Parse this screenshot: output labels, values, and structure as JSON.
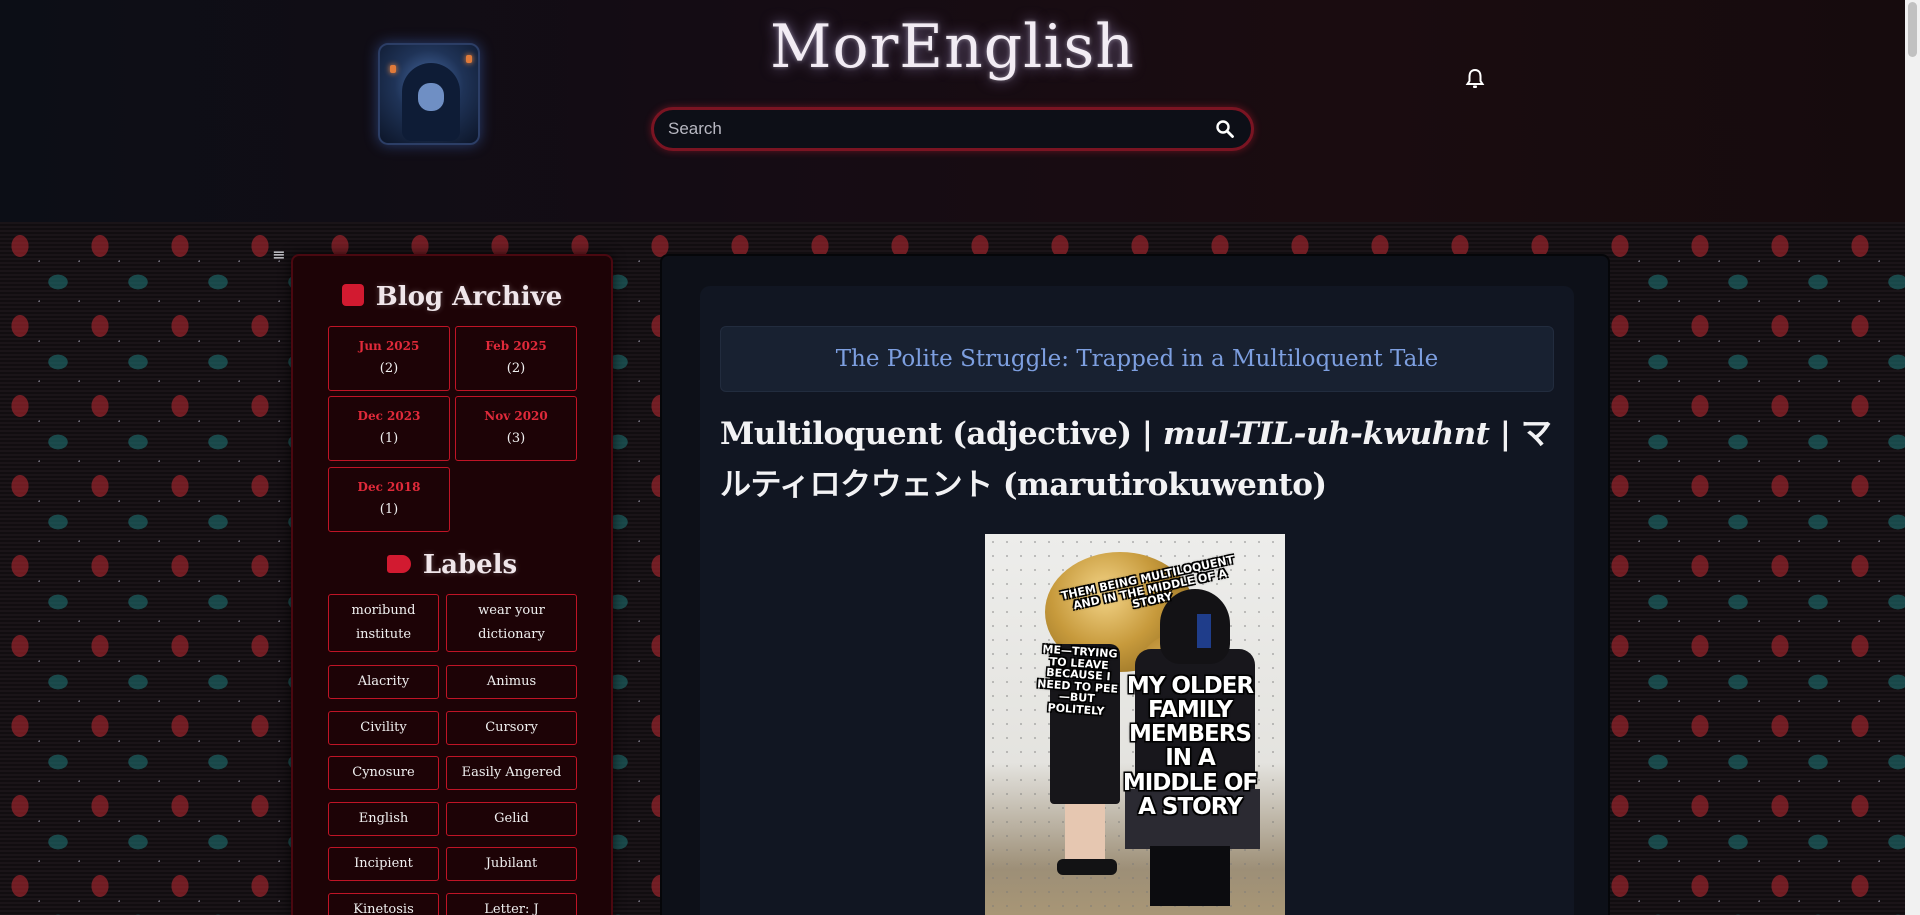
{
  "header": {
    "site_title": "MorEnglish",
    "search_placeholder": "Search",
    "search_icon": "search-icon",
    "bell_icon": "bell-icon"
  },
  "sidebar": {
    "menu_icon": "≡",
    "archive": {
      "title": "Blog Archive",
      "items": [
        {
          "month": "Jun 2025",
          "count": "(2)"
        },
        {
          "month": "Feb 2025",
          "count": "(2)"
        },
        {
          "month": "Dec 2023",
          "count": "(1)"
        },
        {
          "month": "Nov 2020",
          "count": "(3)"
        },
        {
          "month": "Dec 2018",
          "count": "(1)"
        }
      ]
    },
    "labels": {
      "title": "Labels",
      "items": [
        "moribund institute",
        "wear your dictionary",
        "Alacrity",
        "Animus",
        "Civility",
        "Cursory",
        "Cynosure",
        "Easily Angered",
        "English",
        "Gelid",
        "Incipient",
        "Jubilant",
        "Kinetosis",
        "Letter: J"
      ]
    }
  },
  "post": {
    "title": "The Polite Struggle: Trapped in a Multiloquent Tale",
    "heading_part1": "Multiloquent (adjective) | ",
    "heading_pron": "mul-TIL-uh-kwuhnt",
    "heading_part2": " | マルティロクウェント (marutirokuwento)",
    "meme": {
      "top_caption": "THEM BEING MULTILOQUENT AND IN THE MIDDLE OF A STORY",
      "left_caption": "ME—TRYING TO LEAVE BECAUSE I NEED TO PEE—BUT POLITELY",
      "right_caption": "MY OLDER FAMILY MEMBERS IN A MIDDLE OF A STORY"
    }
  },
  "colors": {
    "accent_red": "#c01426",
    "title_blue": "#7d9fe0",
    "sidebar_bg": "#1d0306",
    "main_bg": "#0d1018"
  }
}
